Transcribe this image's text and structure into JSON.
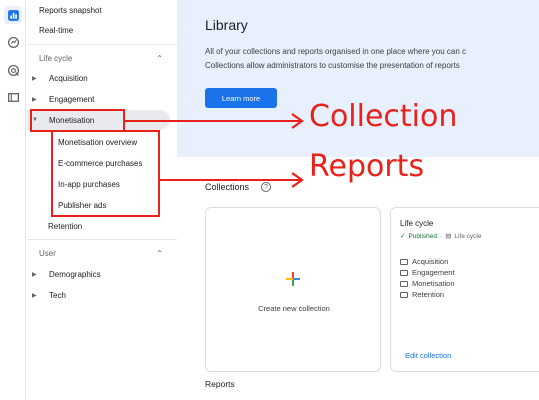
{
  "rail": {
    "icons": [
      "reports-icon",
      "explore-icon",
      "advertising-icon",
      "library-icon"
    ]
  },
  "nav": {
    "reports_snapshot": "Reports snapshot",
    "realtime": "Real-time",
    "lifecycle": {
      "label": "Life cycle",
      "items": {
        "acquisition": "Acquisition",
        "engagement": "Engagement",
        "monetisation": "Monetisation",
        "retention": "Retention"
      },
      "sub_items": [
        "Monetisation overview",
        "E-commerce purchases",
        "In-app purchases",
        "Publisher ads"
      ]
    },
    "user": {
      "label": "User",
      "items": {
        "demographics": "Demographics",
        "tech": "Tech"
      }
    }
  },
  "library": {
    "title": "Library",
    "line1": "All of your collections and reports organised in one place where you can c",
    "line2": "Collections allow administrators to customise the presentation of reports",
    "learn_more": "Learn more",
    "collections_title": "Collections",
    "help_glyph": "?",
    "create_label": "Create new collection",
    "lifecycle_card": {
      "title": "Life cycle",
      "status": "Published",
      "template": "Life cycle",
      "items": [
        "Acquisition",
        "Engagement",
        "Monetisation",
        "Retention"
      ],
      "edit": "Edit collection"
    },
    "reports_title": "Reports"
  },
  "annotations": {
    "collection": "Collection",
    "reports": "Reports",
    "color": "#e8221b"
  },
  "colors": {
    "accent": "#1a73e8",
    "banner": "#e8f0fe",
    "published": "#137333"
  }
}
